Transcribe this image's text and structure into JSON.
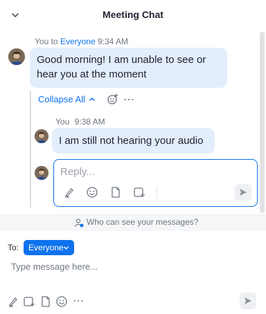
{
  "header": {
    "title": "Meeting Chat",
    "collapse_icon": "chevron-down-icon"
  },
  "messages": [
    {
      "sender": "You",
      "connector": "to",
      "recipient": "Everyone",
      "time": "9:34 AM",
      "text": "Good morning! I am unable to see or hear you at the moment"
    }
  ],
  "thread": {
    "collapse_label": "Collapse All",
    "collapse_icon": "chevron-up-icon",
    "reaction_icon": "emoji-add-icon",
    "more_icon": "more-horizontal-icon",
    "replies": [
      {
        "sender": "You",
        "time": "9:38 AM",
        "text": "I am still not hearing your audio"
      }
    ],
    "reply_box": {
      "placeholder": "Reply...",
      "tools": [
        "format-icon",
        "emoji-icon",
        "file-icon",
        "screenshot-icon"
      ],
      "send_icon": "send-icon"
    }
  },
  "privacy": {
    "text": "Who can see your messages?",
    "icon": "user-lock-icon"
  },
  "composer": {
    "to_label": "To:",
    "recipient": "Everyone",
    "placeholder": "Type message here...",
    "tools": [
      "format-icon",
      "screenshot-icon",
      "file-icon",
      "emoji-icon",
      "more-horizontal-icon"
    ],
    "send_icon": "send-icon"
  },
  "colors": {
    "accent": "#0e72ed",
    "bubble": "#e3eefc",
    "text": "#232333",
    "muted": "#6e7680"
  }
}
